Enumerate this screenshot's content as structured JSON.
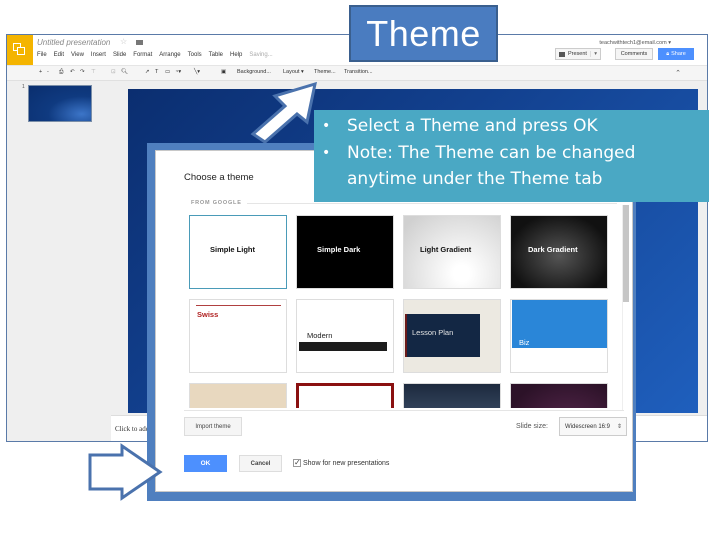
{
  "slide_title": "Theme",
  "instructions": [
    "Select a Theme and press OK",
    "Note: The Theme can be changed anytime under the Theme tab"
  ],
  "instructions_display": {
    "line1": "Select a Theme and press OK",
    "line2": "Note: The Theme can be changed",
    "line3": "anytime under the Theme tab"
  },
  "app": {
    "doc_title": "Untitled presentation",
    "menu": [
      "File",
      "Edit",
      "View",
      "Insert",
      "Slide",
      "Format",
      "Arrange",
      "Tools",
      "Table",
      "Help"
    ],
    "saving_status": "Saving...",
    "user_email": "teachwithtech1@email.com",
    "present_label": "Present",
    "comments_label": "Comments",
    "share_label": "Share",
    "toolbar": {
      "background": "Background...",
      "layout": "Layout",
      "theme": "Theme...",
      "transition": "Transition..."
    },
    "slide_number": "1",
    "notes_placeholder": "Click to add notes"
  },
  "dialog": {
    "title": "Choose a theme",
    "section": "FROM GOOGLE",
    "themes": [
      {
        "name": "Simple Light",
        "selected": true
      },
      {
        "name": "Simple Dark",
        "selected": false
      },
      {
        "name": "Light Gradient",
        "selected": false
      },
      {
        "name": "Dark Gradient",
        "selected": false
      },
      {
        "name": "Swiss",
        "selected": false
      },
      {
        "name": "Modern",
        "selected": false
      },
      {
        "name": "Lesson Plan",
        "selected": false
      },
      {
        "name": "Biz",
        "selected": false
      },
      {
        "name": "",
        "selected": false
      },
      {
        "name": "",
        "selected": false
      },
      {
        "name": "",
        "selected": false
      },
      {
        "name": "",
        "selected": false
      }
    ],
    "import_label": "Import theme",
    "slide_size_label": "Slide size:",
    "slide_size_value": "Widescreen 16:9",
    "ok_label": "OK",
    "cancel_label": "Cancel",
    "show_new_label": "Show for new presentations",
    "show_new_checked": true
  },
  "colors": {
    "accent_blue": "#4a7cc0",
    "callout": "#4aa8c4",
    "share_button": "#4d90fe",
    "logo": "#f4b400"
  }
}
